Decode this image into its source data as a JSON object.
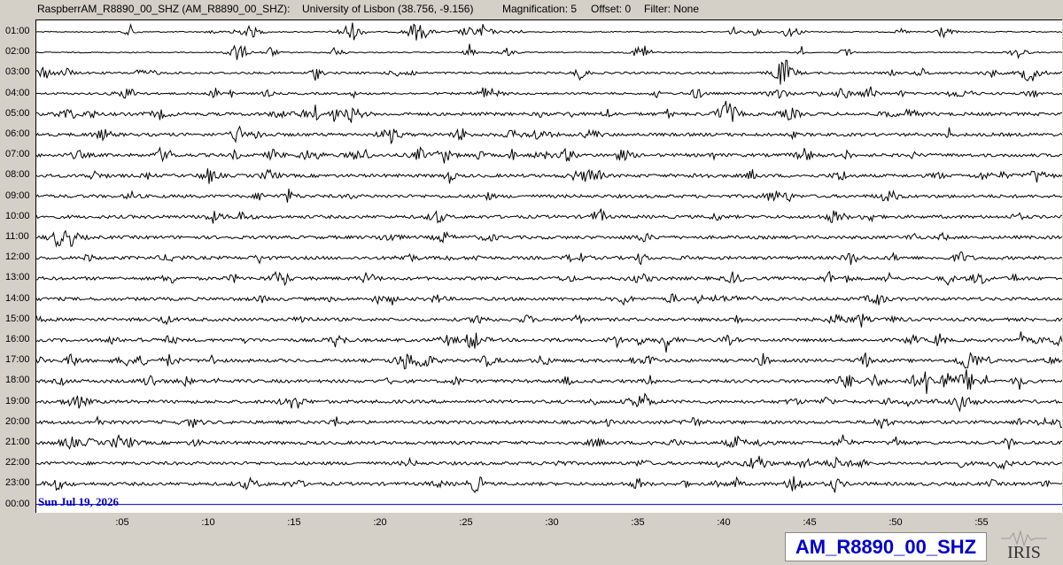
{
  "header": {
    "channel": "RaspberrAM_R8890_00_SHZ (AM_R8890_00_SHZ):",
    "location": "University of Lisbon (38.756, -9.156)",
    "magnification": "Magnification: 5",
    "offset": "Offset: 0",
    "filter": "Filter: None"
  },
  "hours": [
    "01:00",
    "02:00",
    "03:00",
    "04:00",
    "05:00",
    "06:00",
    "07:00",
    "08:00",
    "09:00",
    "10:00",
    "11:00",
    "12:00",
    "13:00",
    "14:00",
    "15:00",
    "16:00",
    "17:00",
    "18:00",
    "19:00",
    "20:00",
    "21:00",
    "22:00",
    "23:00",
    "00:00"
  ],
  "minute_ticks": [
    ":05",
    ":10",
    ":15",
    ":20",
    ":25",
    ":30",
    ":35",
    ":40",
    ":45",
    ":50",
    ":55"
  ],
  "date": "Sun Jul 19, 2026",
  "station": "AM_R8890_00_SHZ",
  "logo_text": "IRIS",
  "colors": {
    "trace": "#000000",
    "current_line": "#0000cc",
    "date": "#0000cc",
    "background": "#d4d0c8",
    "plot": "#ffffff"
  }
}
